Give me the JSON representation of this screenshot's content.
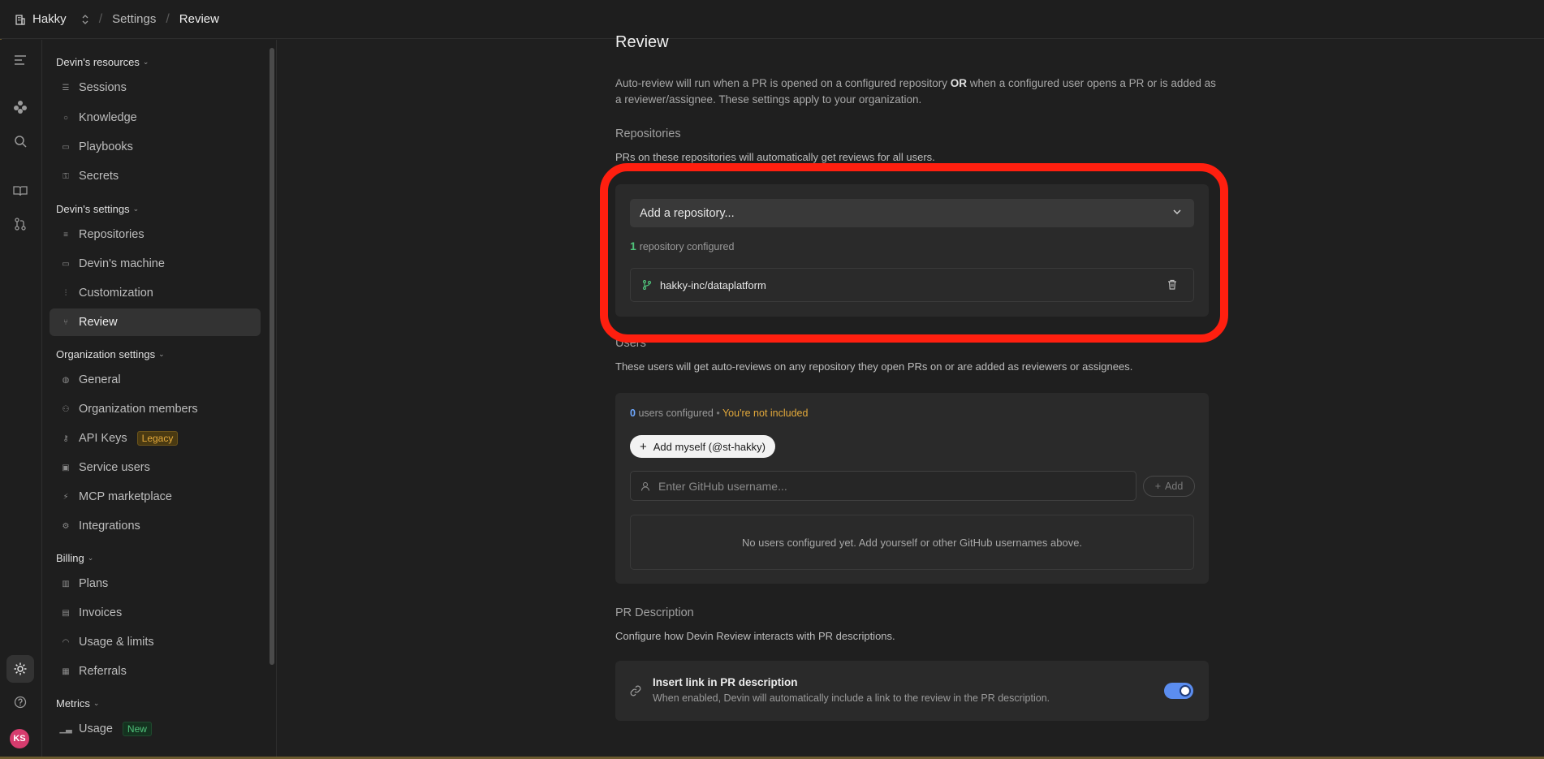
{
  "topbar": {
    "org_name": "Hakky",
    "crumbs": [
      "Settings",
      "Review"
    ]
  },
  "rail": {
    "icons": [
      "sidebar-toggle-icon",
      "devin-logo-icon",
      "search-icon",
      "book-icon",
      "git-pull-request-icon",
      "settings-icon",
      "help-icon"
    ],
    "avatar_initials": "KS"
  },
  "sidebar": {
    "sections": [
      {
        "title": "Devin's resources",
        "items": [
          "Sessions",
          "Knowledge",
          "Playbooks",
          "Secrets"
        ]
      },
      {
        "title": "Devin's settings",
        "items": [
          "Repositories",
          "Devin's machine",
          "Customization",
          "Review"
        ]
      },
      {
        "title": "Organization settings",
        "items": [
          "General",
          "Organization members",
          "API Keys",
          "Service users",
          "MCP marketplace",
          "Integrations"
        ]
      },
      {
        "title": "Billing",
        "items": [
          "Plans",
          "Invoices",
          "Usage & limits",
          "Referrals"
        ]
      },
      {
        "title": "Metrics",
        "items": [
          "Usage"
        ]
      }
    ],
    "active_item": "Review",
    "badges": {
      "api_keys": "Legacy",
      "usage": "New"
    }
  },
  "main": {
    "title": "Review",
    "description_part1": "Auto-review will run when a PR is opened on a configured repository ",
    "description_bold": "OR",
    "description_part2": " when a configured user opens a PR or is added as a reviewer/assignee. These settings apply to your organization.",
    "repositories": {
      "title": "Repositories",
      "subtitle": "PRs on these repositories will automatically get reviews for all users.",
      "select_placeholder": "Add a repository...",
      "configured_count": "1",
      "configured_label": "repository configured",
      "items": [
        "hakky-inc/dataplatform"
      ]
    },
    "users": {
      "title": "Users",
      "subtitle": "These users will get auto-reviews on any repository they open PRs on or are added as reviewers or assignees.",
      "configured_count": "0",
      "configured_label": "users configured",
      "not_included": "You're not included",
      "add_myself_label": "Add myself (@st-hakky)",
      "input_placeholder": "Enter GitHub username...",
      "add_label": "Add",
      "empty_text": "No users configured yet. Add yourself or other GitHub usernames above."
    },
    "pr_description": {
      "title": "PR Description",
      "subtitle": "Configure how Devin Review interacts with PR descriptions.",
      "setting_title": "Insert link in PR description",
      "setting_desc": "When enabled, Devin will automatically include a link to the review in the PR description.",
      "enabled": true
    }
  },
  "colors": {
    "highlight": "#ff1f0f",
    "toggle_on": "#5b8def",
    "count_green": "#4fc27a",
    "count_blue": "#6ea8ff",
    "warning": "#e3a93b"
  }
}
